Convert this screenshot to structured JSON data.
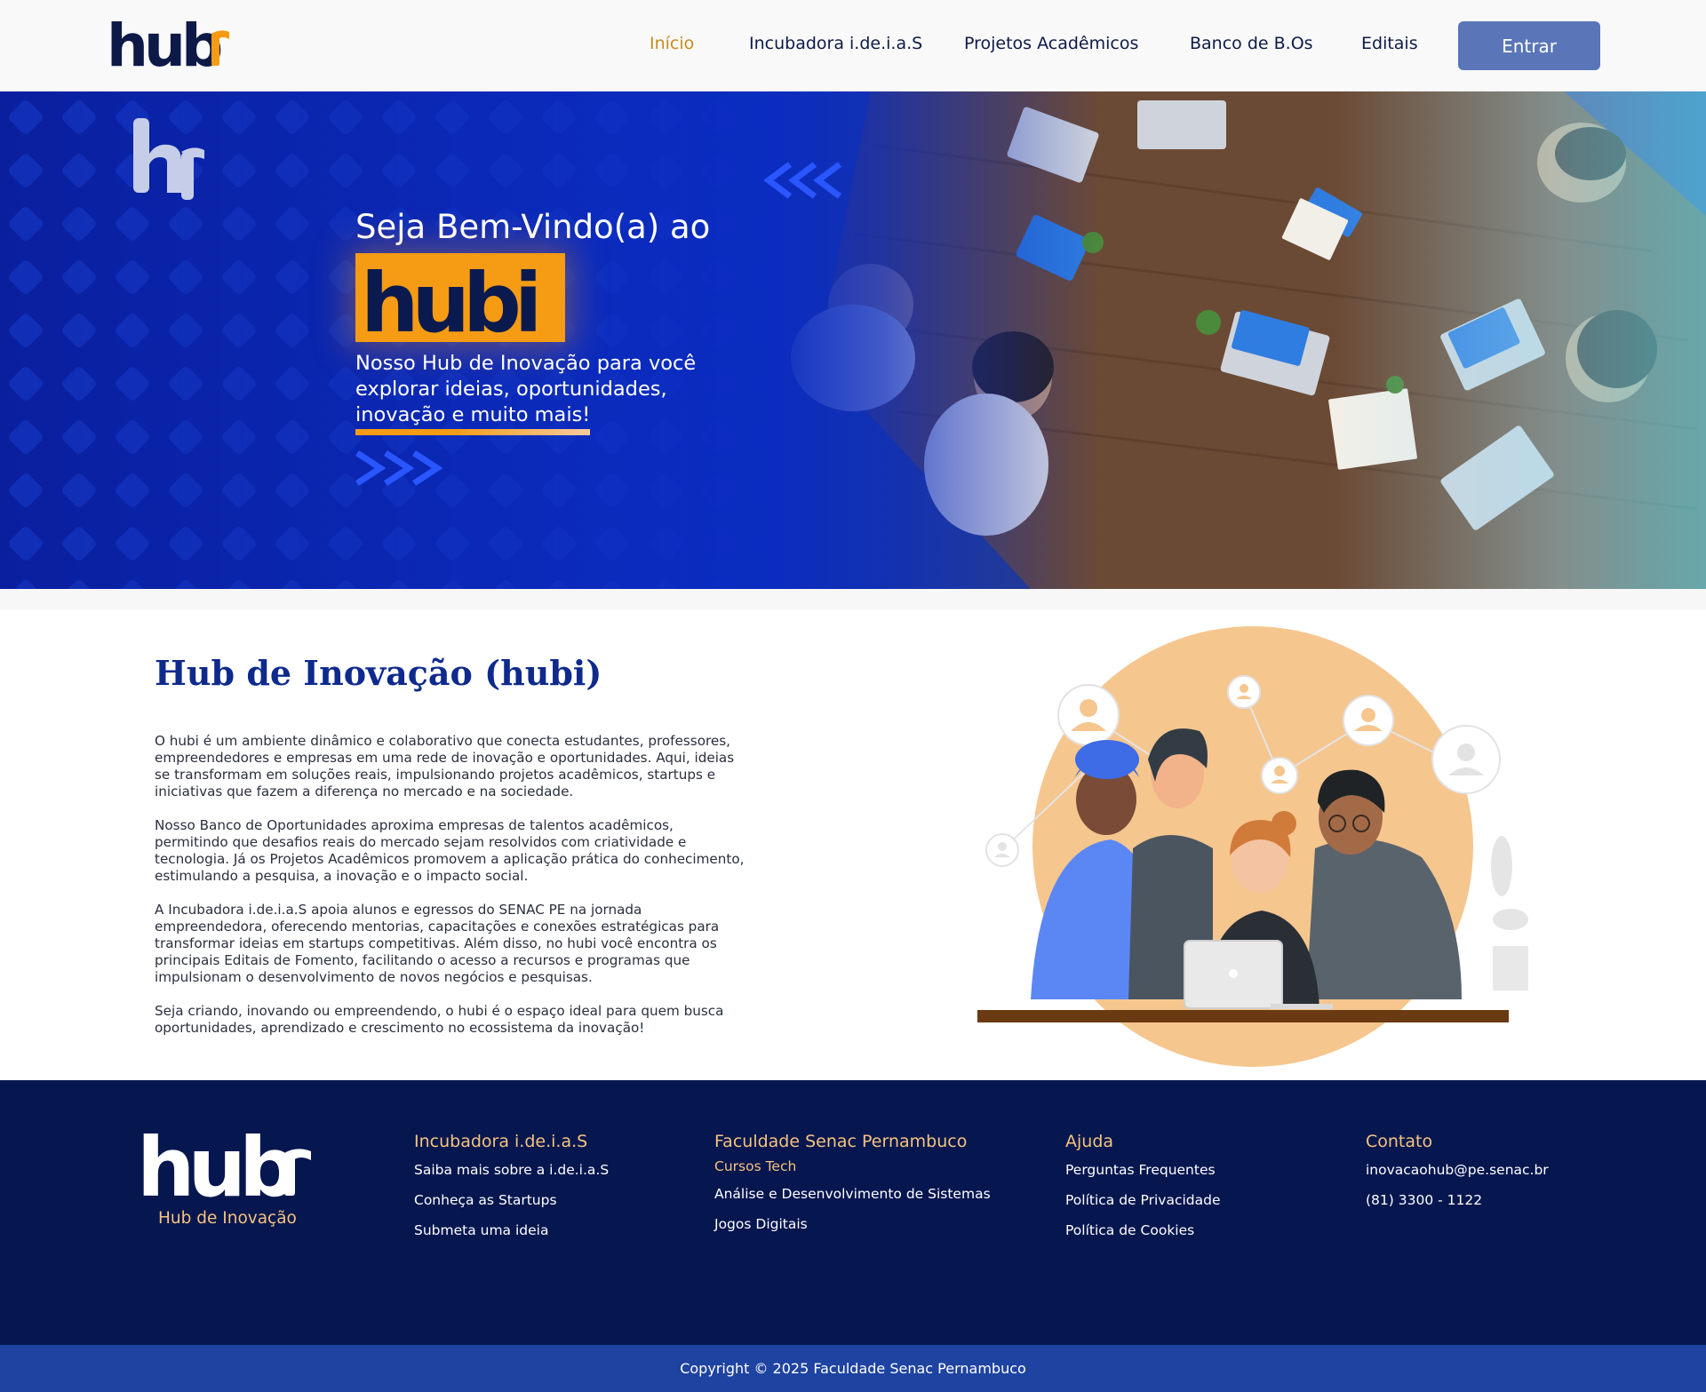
{
  "header": {
    "logo_alt": "hubi",
    "nav": [
      {
        "label": "Início",
        "active": true
      },
      {
        "label": "Incubadora i.de.i.a.S",
        "active": false
      },
      {
        "label": "Projetos Acadêmicos",
        "active": false
      },
      {
        "label": "Banco de B.Os",
        "active": false
      },
      {
        "label": "Editais",
        "active": false
      }
    ],
    "login_label": "Entrar"
  },
  "hero": {
    "welcome": "Seja Bem-Vindo(a) ao",
    "badge_text": "hubi",
    "subtitle": "Nosso Hub de Inovação para você explorar ideias, oportunidades, inovação e muito mais!"
  },
  "about": {
    "title": "Hub de Inovação (hubi)",
    "paragraphs": [
      "O hubi é um ambiente dinâmico e colaborativo que conecta estudantes, professores, empreendedores e empresas em uma rede de inovação e oportunidades. Aqui, ideias se transformam em soluções reais, impulsionando projetos acadêmicos, startups e iniciativas que fazem a diferença no mercado e na sociedade.",
      "Nosso Banco de Oportunidades aproxima empresas de talentos acadêmicos, permitindo que desafios reais do mercado sejam resolvidos com criatividade e tecnologia. Já os Projetos Acadêmicos promovem a aplicação prática do conhecimento, estimulando a pesquisa, a inovação e o impacto social.",
      "A Incubadora i.de.i.a.S apoia alunos e egressos do SENAC PE na jornada empreendedora, oferecendo mentorias, capacitações e conexões estratégicas para transformar ideias em startups competitivas. Além disso, no hubi você encontra os principais Editais de Fomento, facilitando o acesso a recursos e programas que impulsionam o desenvolvimento de novos negócios e pesquisas.",
      "Seja criando, inovando ou empreendendo, o hubi é o espaço ideal para quem busca oportunidades, aprendizado e crescimento no ecossistema da inovação!"
    ]
  },
  "footer": {
    "tagline": "Hub de Inovação",
    "columns": [
      {
        "title": "Incubadora i.de.i.a.S",
        "links": [
          "Saiba mais sobre a i.de.i.a.S",
          "Conheça as Startups",
          "Submeta uma ideia"
        ]
      },
      {
        "title": "Faculdade Senac Pernambuco",
        "subtitle": "Cursos Tech",
        "links": [
          "Análise e Desenvolvimento de Sistemas",
          "Jogos Digitais"
        ]
      },
      {
        "title": "Ajuda",
        "links": [
          "Perguntas Frequentes",
          "Política de Privacidade",
          "Política de Cookies"
        ]
      },
      {
        "title": "Contato",
        "links": [
          "inovacaohub@pe.senac.br",
          "(81) 3300 - 1122"
        ]
      }
    ],
    "copyright": "Copyright © 2025 Faculdade Senac Pernambuco"
  },
  "colors": {
    "brand_navy": "#0d1a48",
    "brand_orange": "#f59b14",
    "hero_blue": "#0a2cc0",
    "footer_bg": "#06164f",
    "accent_gold": "#f4c47f",
    "button_blue": "#5a76b8"
  }
}
